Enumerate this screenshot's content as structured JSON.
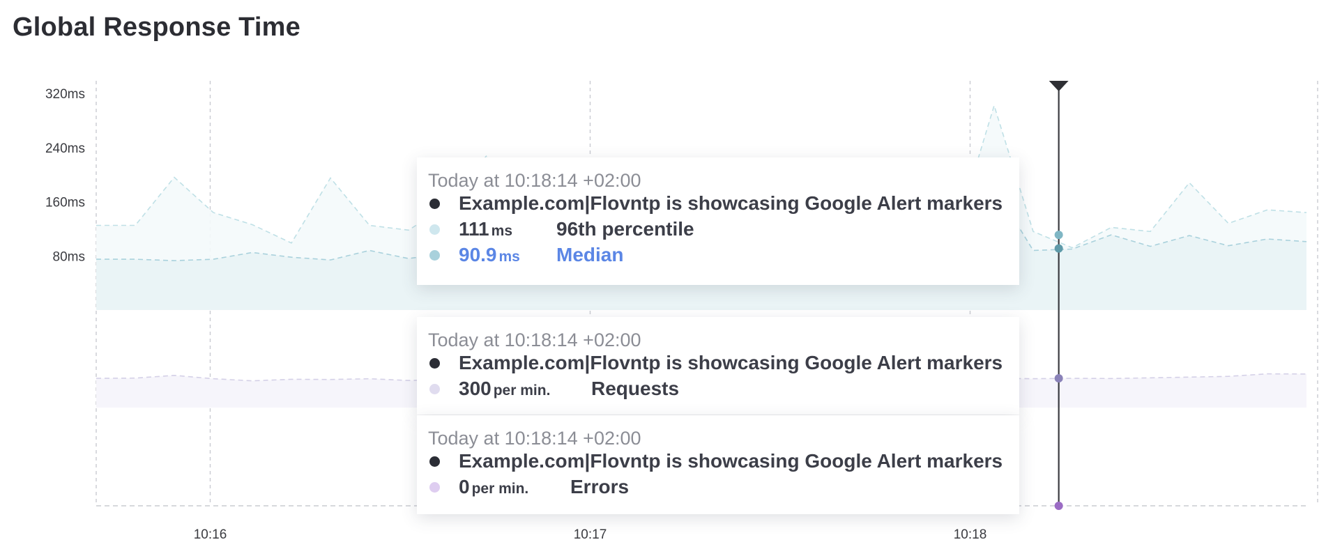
{
  "chart_data": {
    "title": "Global Response Time",
    "type": "area",
    "x_ticks": [
      "10:16",
      "10:17",
      "10:18"
    ],
    "marker_time": "10:18:14",
    "grid": "dashed vertical",
    "panels": [
      {
        "id": "latency",
        "y_ticks": [
          {
            "label": "320ms",
            "value": 320
          },
          {
            "label": "240ms",
            "value": 240
          },
          {
            "label": "160ms",
            "value": 160
          },
          {
            "label": "80ms",
            "value": 80
          }
        ],
        "series": [
          {
            "name": "96th percentile",
            "unit": "ms",
            "color": "#bfe0e6",
            "values": [
              125,
              125,
              196,
              144,
              126,
              99,
              195,
              125,
              118,
              155,
              228,
              162,
              141,
              122,
              132,
              104,
              97,
              136,
              196,
              158,
              169,
              106,
              111,
              302,
              116,
              92,
              122,
              116,
              188,
              128,
              148,
              144
            ]
          },
          {
            "name": "Median",
            "unit": "ms",
            "color": "#a9d1dc",
            "values": [
              75,
              75,
              73,
              75,
              85,
              78,
              74,
              88,
              76,
              84,
              84,
              80,
              76,
              78,
              76,
              78,
              82,
              80,
              79,
              74,
              77,
              85,
              90,
              182,
              88,
              90,
              111,
              94,
              110,
              95,
              105,
              101
            ]
          }
        ]
      },
      {
        "id": "requests",
        "series": [
          {
            "name": "Requests",
            "unit": "per min.",
            "color": "#d4d0e7",
            "values": [
              300,
              302,
              330,
              296,
              274,
              290,
              288,
              296,
              278,
              288,
              290,
              291,
              288,
              286,
              288,
              290,
              289,
              292,
              290,
              288,
              290,
              289,
              292,
              300,
              296,
              300,
              298,
              305,
              312,
              320,
              346,
              344
            ]
          }
        ]
      },
      {
        "id": "errors",
        "series": [
          {
            "name": "Errors",
            "unit": "per min.",
            "color": "#d9c6ea",
            "values": [
              0,
              0,
              0,
              0,
              0,
              0,
              0,
              0,
              0,
              0,
              0,
              0,
              0,
              0,
              0,
              0,
              0,
              0,
              0,
              0,
              0,
              0,
              0,
              0,
              0,
              0,
              0,
              0,
              0,
              0,
              0,
              0
            ]
          }
        ]
      }
    ]
  },
  "tooltips": [
    {
      "time": "Today at 10:18:14 +02:00",
      "monitor": "Example.com|Flovntp is showcasing Google Alert markers",
      "monitor_color": "#2b2d35",
      "rows": [
        {
          "value": "111",
          "unit": "ms",
          "metric": "96th percentile",
          "color": "#cfe7ee"
        },
        {
          "value": "90.9",
          "unit": "ms",
          "metric": "Median",
          "color": "#a9d1dc"
        }
      ]
    },
    {
      "time": "Today at 10:18:14 +02:00",
      "monitor": "Example.com|Flovntp is showcasing Google Alert markers",
      "monitor_color": "#2b2d35",
      "rows": [
        {
          "value": "300",
          "unit": "per min.",
          "metric": "Requests",
          "color": "#e0dcef"
        }
      ]
    },
    {
      "time": "Today at 10:18:14 +02:00",
      "monitor": "Example.com|Flovntp is showcasing Google Alert markers",
      "monitor_color": "#2b2d35",
      "rows": [
        {
          "value": "0",
          "unit": "per min.",
          "metric": "Errors",
          "color": "#decdf0"
        }
      ]
    }
  ]
}
